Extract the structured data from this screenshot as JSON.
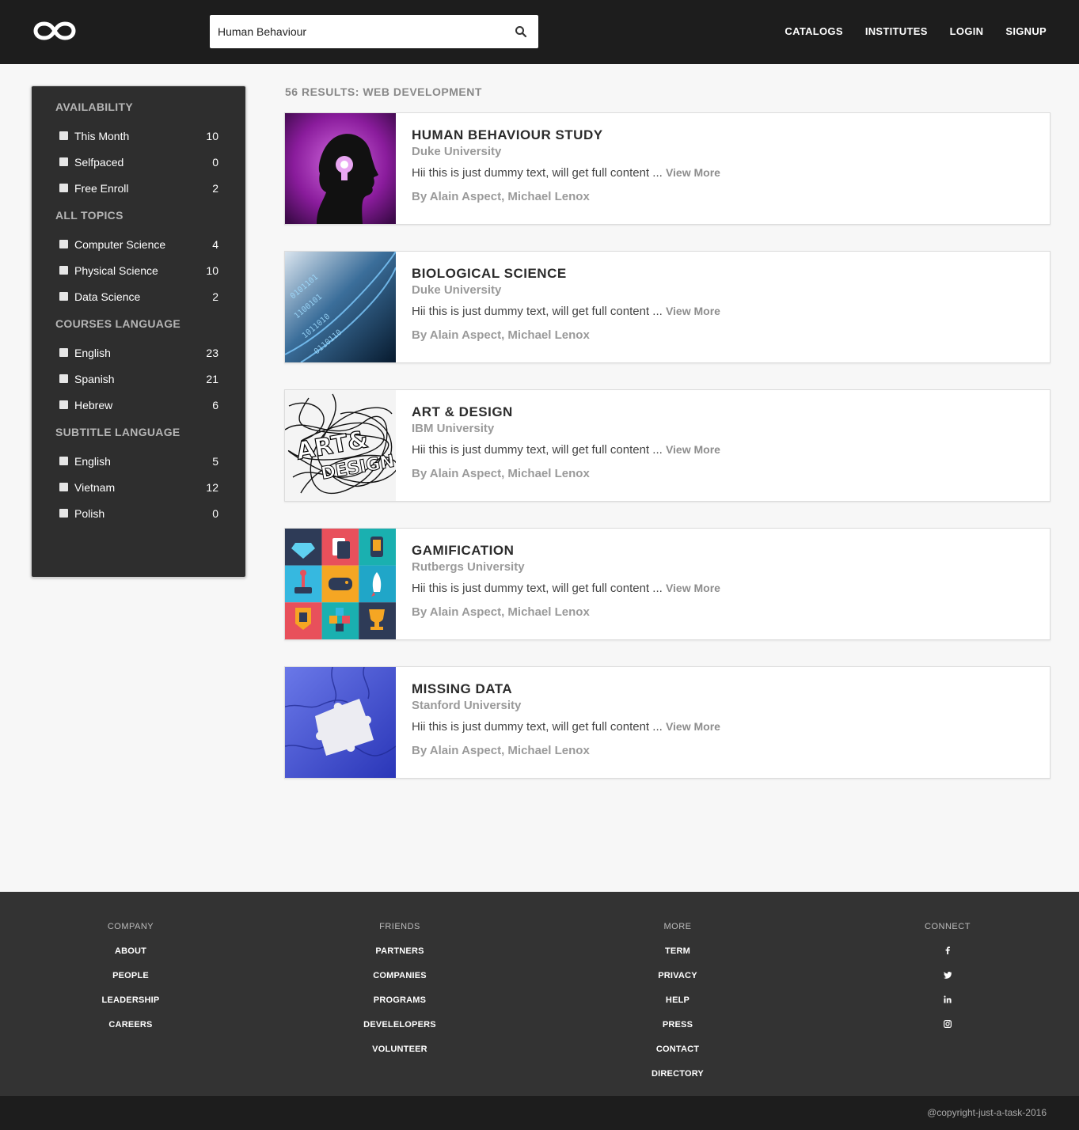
{
  "header": {
    "search_value": "Human Behaviour",
    "nav": [
      "CATALOGS",
      "INSTITUTES",
      "LOGIN",
      "SIGNUP"
    ]
  },
  "sidebar": {
    "groups": [
      {
        "title": "AVAILABILITY",
        "items": [
          {
            "label": "This Month",
            "count": "10"
          },
          {
            "label": "Selfpaced",
            "count": "0"
          },
          {
            "label": "Free Enroll",
            "count": "2"
          }
        ]
      },
      {
        "title": "ALL TOPICS",
        "items": [
          {
            "label": "Computer Science",
            "count": "4"
          },
          {
            "label": "Physical Science",
            "count": "10"
          },
          {
            "label": "Data Science",
            "count": "2"
          }
        ]
      },
      {
        "title": "COURSES LANGUAGE",
        "items": [
          {
            "label": "English",
            "count": "23"
          },
          {
            "label": "Spanish",
            "count": "21"
          },
          {
            "label": "Hebrew",
            "count": "6"
          }
        ]
      },
      {
        "title": "SUBTITLE LANGUAGE",
        "items": [
          {
            "label": "English",
            "count": "5"
          },
          {
            "label": "Vietnam",
            "count": "12"
          },
          {
            "label": "Polish",
            "count": "0"
          }
        ]
      }
    ]
  },
  "results": {
    "title": "56 RESULTS: WEB DEVELOPMENT",
    "cards": [
      {
        "title": "HUMAN BEHAVIOUR STUDY",
        "university": "Duke University",
        "description": "Hii this is just dummy text, will get full content ...",
        "more": "View More",
        "authors": "By Alain Aspect, Michael Lenox"
      },
      {
        "title": "BIOLOGICAL SCIENCE",
        "university": "Duke University",
        "description": "Hii this is just dummy text, will get full content ...",
        "more": "View More",
        "authors": "By Alain Aspect, Michael Lenox"
      },
      {
        "title": "ART & DESIGN",
        "university": "IBM University",
        "description": "Hii this is just dummy text, will get full content ...",
        "more": "View More",
        "authors": "By Alain Aspect, Michael Lenox"
      },
      {
        "title": "GAMIFICATION",
        "university": "Rutbergs University",
        "description": "Hii this is just dummy text, will get full content ...",
        "more": "View More",
        "authors": "By Alain Aspect, Michael Lenox"
      },
      {
        "title": "MISSING DATA",
        "university": "Stanford University",
        "description": "Hii this is just dummy text, will get full content ...",
        "more": "View More",
        "authors": "By Alain Aspect, Michael Lenox"
      }
    ]
  },
  "footer": {
    "company": {
      "title": "COMPANY",
      "links": [
        "ABOUT",
        "PEOPLE",
        "LEADERSHIP",
        "CAREERS"
      ]
    },
    "friends": {
      "title": "FRIENDS",
      "links": [
        "PARTNERS",
        "COMPANIES",
        "PROGRAMS",
        "DEVELELOPERS",
        "VOLUNTEER"
      ]
    },
    "more": {
      "title": "MORE",
      "links": [
        "TERM",
        "PRIVACY",
        "HELP",
        "PRESS",
        "CONTACT",
        "DIRECTORY"
      ]
    },
    "connect": {
      "title": "CONNECT",
      "icons": [
        "facebook-icon",
        "twitter-icon",
        "linkedin-icon",
        "instagram-icon"
      ]
    },
    "copyright": "@copyright-just-a-task-2016"
  }
}
